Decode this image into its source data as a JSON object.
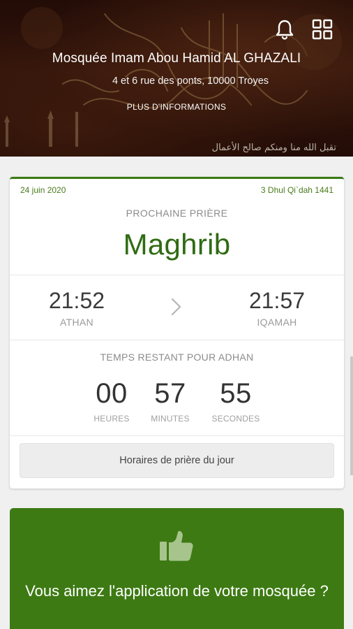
{
  "header": {
    "mosque_name": "Mosquée Imam Abou Hamid AL GHAZALI",
    "address": "4 et 6 rue des ponts, 10000 Troyes",
    "more_info_label": "PLUS D'INFORMATIONS",
    "caption": "تقبل الله منا ومنكم صالح الأعمال",
    "icons": [
      "bell-icon",
      "grid-icon"
    ]
  },
  "card": {
    "gregorian_date": "24 juin 2020",
    "hijri_date": "3 Dhul Qi`dah 1441",
    "next_label": "PROCHAINE PRIÈRE",
    "next_prayer": "Maghrib",
    "athan": {
      "time": "21:52",
      "label": "ATHAN"
    },
    "iqamah": {
      "time": "21:57",
      "label": "IQAMAH"
    },
    "remaining_label": "TEMPS RESTANT POUR ADHAN",
    "countdown": [
      {
        "value": "00",
        "label": "HEURES"
      },
      {
        "value": "57",
        "label": "MINUTES"
      },
      {
        "value": "55",
        "label": "SECONDES"
      }
    ],
    "schedule_button": "Horaires de prière du jour"
  },
  "rate_card": {
    "text": "Vous aimez l'application de votre mosquée ?"
  },
  "colors": {
    "accent": "#3d7a13",
    "prayer_name": "#2f6b12"
  }
}
